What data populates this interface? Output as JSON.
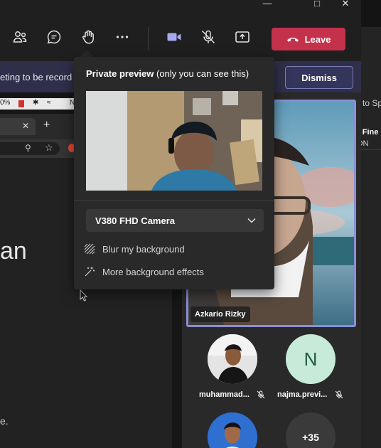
{
  "toolbar": {
    "icons": [
      "people-icon",
      "chat-icon",
      "raise-hand-icon",
      "more-icon",
      "camera-icon",
      "mic-off-icon",
      "share-icon"
    ],
    "leave_label": "Leave",
    "leave_color": "#c4314b"
  },
  "recording_banner": {
    "text": "eting to be record",
    "dismiss_label": "Dismiss"
  },
  "preview": {
    "title_bold": "Private preview",
    "title_rest": " (only you can see this)",
    "camera_selected": "V380 FHD Camera",
    "effects": [
      {
        "label": "Blur my background",
        "icon": "blur-icon"
      },
      {
        "label": "More background effects",
        "icon": "effects-icon"
      }
    ]
  },
  "shared_screen": {
    "status_text": "0%",
    "status_extra": "N",
    "big_text": "an",
    "trailing_text": "e."
  },
  "spotlight": {
    "name": "Azkario Rizky"
  },
  "participants": [
    {
      "name": "muhammad...",
      "avatar": "photo",
      "muted": true
    },
    {
      "name": "najma.previ...",
      "avatar": "N",
      "muted": true
    },
    {
      "name": "",
      "avatar": "photo",
      "muted": false
    },
    {
      "name": "",
      "avatar": "+35",
      "muted": false
    }
  ],
  "right_panel": {
    "line1": "to Sp",
    "line2": "o Fine",
    "line3": "ON"
  },
  "colors": {
    "accent": "#8b8fd8",
    "banner": "#2f2f4a",
    "avatar_n_bg": "#c8ead8",
    "avatar_n_fg": "#1b5e3a"
  }
}
